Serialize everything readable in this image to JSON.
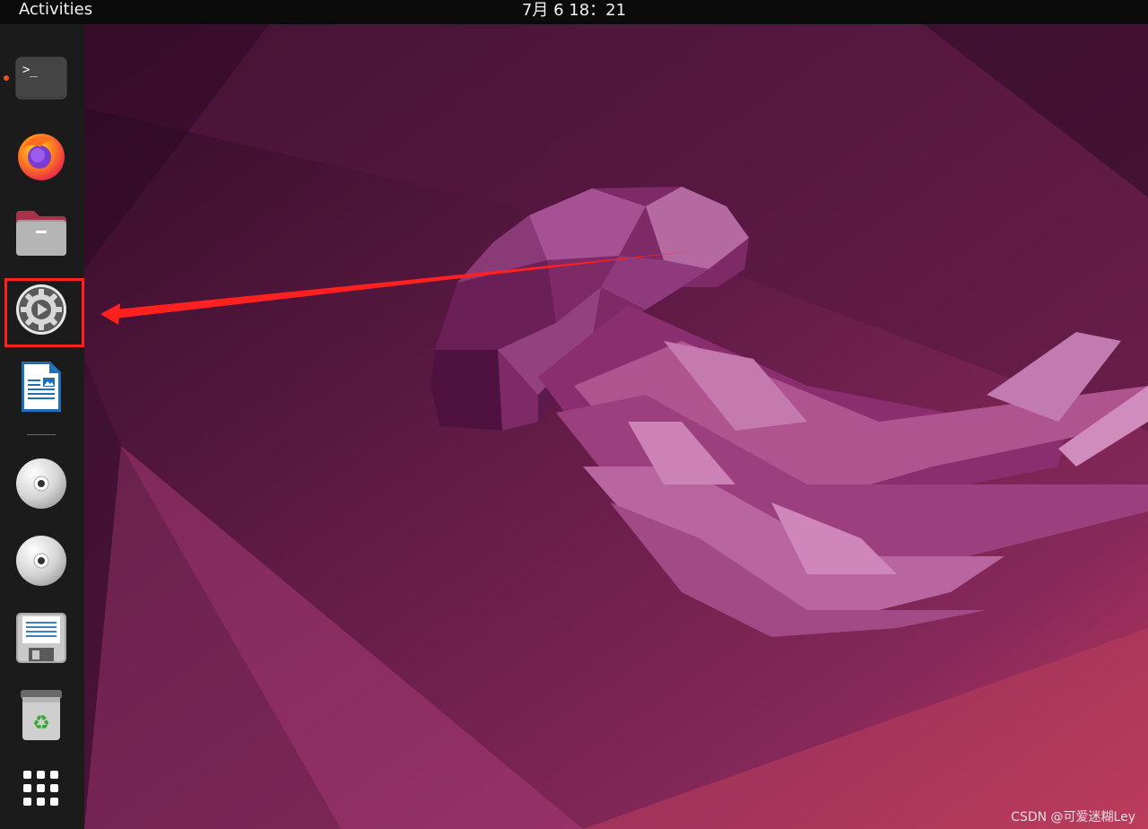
{
  "topbar": {
    "activities_label": "Activities",
    "clock": "7月 6  18：21"
  },
  "dock": {
    "items": [
      {
        "name": "terminal",
        "icon": "terminal-icon",
        "running": true,
        "glyph": ">_"
      },
      {
        "name": "firefox",
        "icon": "firefox-icon",
        "running": false
      },
      {
        "name": "files",
        "icon": "folder-icon",
        "running": false
      },
      {
        "name": "settings",
        "icon": "gear-icon",
        "running": false,
        "highlighted": true
      },
      {
        "name": "writer",
        "icon": "document-icon",
        "running": false
      },
      {
        "name": "disc-1",
        "icon": "disc-icon",
        "running": false
      },
      {
        "name": "disc-2",
        "icon": "disc-icon",
        "running": false
      },
      {
        "name": "save",
        "icon": "floppy-icon",
        "running": false
      },
      {
        "name": "trash",
        "icon": "trash-icon",
        "running": false
      },
      {
        "name": "show-apps",
        "icon": "app-grid-icon",
        "running": false
      }
    ]
  },
  "annotation": {
    "color": "#ff2020"
  },
  "watermark": "CSDN @可爱迷糊Ley",
  "colors": {
    "topbar": "#0b0b0b",
    "dock": "#1b1b1b",
    "accent": "#e95420",
    "wallpaper_dark": "#2c0a22",
    "wallpaper_mid": "#6b1d4d",
    "wallpaper_light": "#c2375e"
  }
}
